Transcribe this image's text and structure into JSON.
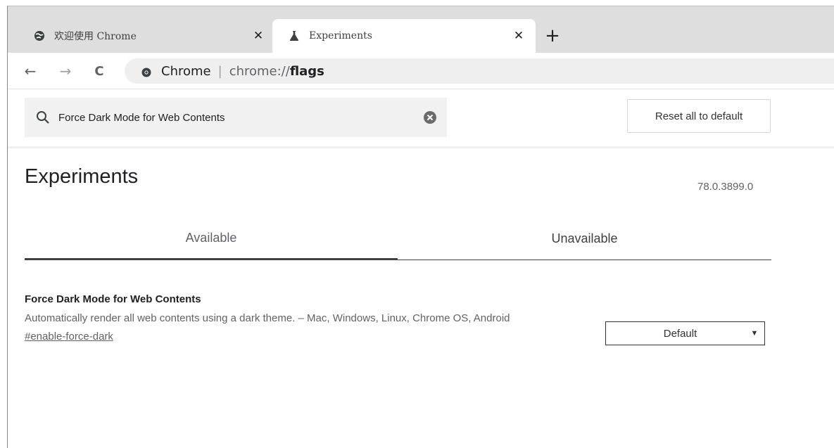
{
  "tabs": [
    {
      "title": "欢迎使用 Chrome",
      "icon": "globe-icon",
      "active": false,
      "close": "✕"
    },
    {
      "title": "Experiments",
      "icon": "flask-icon",
      "active": true,
      "close": "✕"
    }
  ],
  "new_tab": "+",
  "nav": {
    "back": "←",
    "forward": "→",
    "reload": "C"
  },
  "omnibox": {
    "site_name": "Chrome",
    "separator": "|",
    "url_prefix": "chrome://",
    "url_path": "flags"
  },
  "search": {
    "value": "Force Dark Mode for Web Contents"
  },
  "reset_button": "Reset all to default",
  "page": {
    "title": "Experiments",
    "version": "78.0.3899.0"
  },
  "flag_tabs": [
    {
      "label": "Available",
      "selected": true
    },
    {
      "label": "Unavailable",
      "selected": false
    }
  ],
  "experiment": {
    "name": "Force Dark Mode for Web Contents",
    "description": "Automatically render all web contents using a dark theme. – Mac, Windows, Linux, Chrome OS, Android",
    "link": "#enable-force-dark",
    "select_value": "Default"
  },
  "colors": {
    "tabstrip": "#dedede",
    "omnibox": "#efefef",
    "searchbox": "#f1f1f1"
  }
}
